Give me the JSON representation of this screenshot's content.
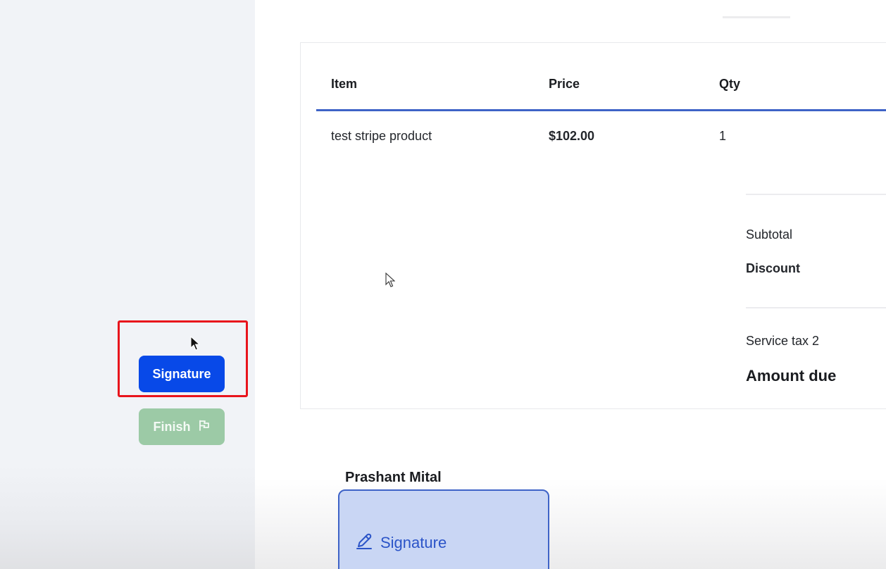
{
  "sidebar": {
    "signature_label": "Signature",
    "finish_label": "Finish",
    "finish_icon": "flag-icon",
    "highlight_color": "#e8141c",
    "signature_color": "#0849e8",
    "finish_color": "#9ccaa6"
  },
  "table": {
    "headers": [
      "Item",
      "Price",
      "Qty"
    ],
    "rows": [
      {
        "item": "test stripe product",
        "price": "$102.00",
        "qty": "1"
      }
    ]
  },
  "summary": {
    "subtotal_label": "Subtotal",
    "discount_label": "Discount",
    "tax_label": "Service tax 2",
    "amount_due_label": "Amount due"
  },
  "signer": {
    "name": "Prashant Mital",
    "signature_field_label": "Signature",
    "signature_icon": "pen-icon",
    "field_bg": "#c9d6f4",
    "field_border": "#3e63c7"
  }
}
